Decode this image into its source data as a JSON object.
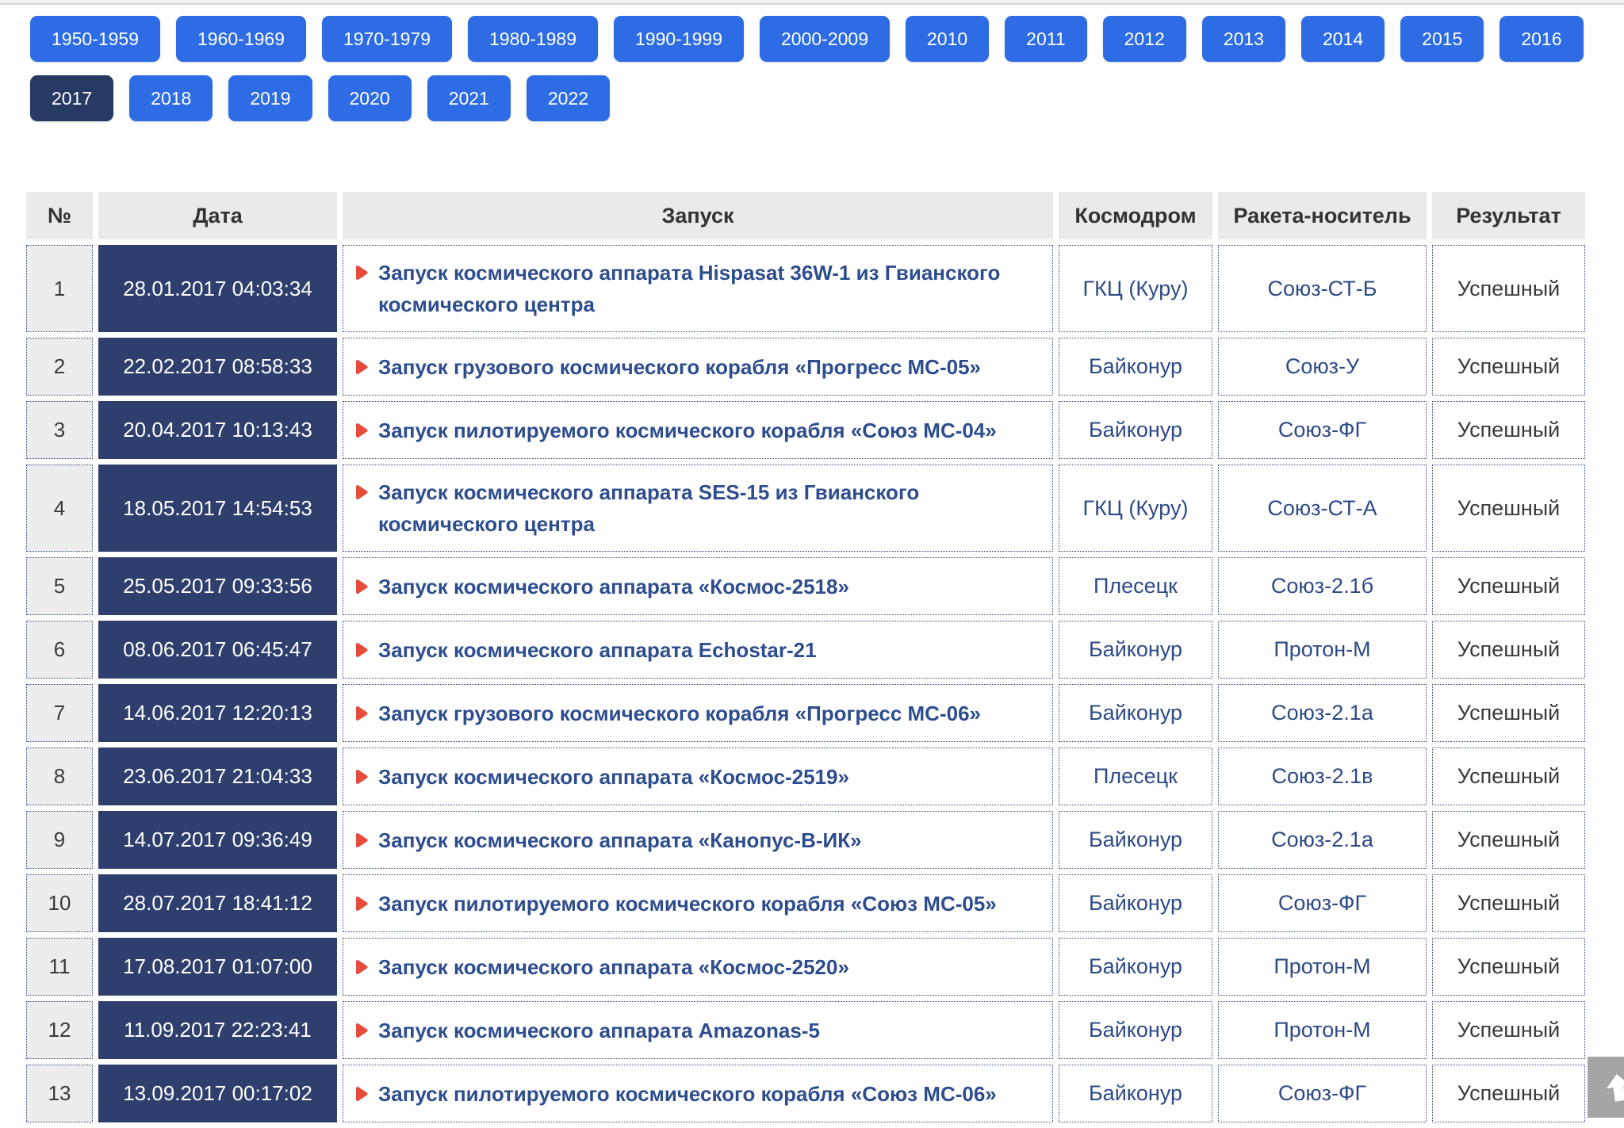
{
  "filters": {
    "active": "2017",
    "rows": [
      [
        "1950-1959",
        "1960-1969",
        "1970-1979",
        "1980-1989",
        "1990-1999",
        "2000-2009",
        "2010",
        "2011",
        "2012",
        "2013",
        "2014",
        "2015",
        "2016"
      ],
      [
        "2017",
        "2018",
        "2019",
        "2020",
        "2021",
        "2022"
      ]
    ]
  },
  "table": {
    "headers": [
      "№",
      "Дата",
      "Запуск",
      "Космодром",
      "Ракета-носитель",
      "Результат"
    ],
    "rows": [
      {
        "num": "1",
        "date": "28.01.2017 04:03:34",
        "launch": "Запуск космического аппарата Hispasat 36W-1 из Гвианского космического центра",
        "cosmodrome": "ГКЦ (Куру)",
        "rocket": "Союз-СТ-Б",
        "result": "Успешный"
      },
      {
        "num": "2",
        "date": "22.02.2017 08:58:33",
        "launch": "Запуск грузового космического корабля «Прогресс МС-05»",
        "cosmodrome": "Байконур",
        "rocket": "Союз-У",
        "result": "Успешный"
      },
      {
        "num": "3",
        "date": "20.04.2017 10:13:43",
        "launch": "Запуск пилотируемого космического корабля «Союз МС-04»",
        "cosmodrome": "Байконур",
        "rocket": "Союз-ФГ",
        "result": "Успешный"
      },
      {
        "num": "4",
        "date": "18.05.2017 14:54:53",
        "launch": "Запуск космического аппарата SES-15 из Гвианского космического центра",
        "cosmodrome": "ГКЦ (Куру)",
        "rocket": "Союз-СТ-А",
        "result": "Успешный"
      },
      {
        "num": "5",
        "date": "25.05.2017 09:33:56",
        "launch": "Запуск космического аппарата «Космос-2518»",
        "cosmodrome": "Плесецк",
        "rocket": "Союз-2.1б",
        "result": "Успешный"
      },
      {
        "num": "6",
        "date": "08.06.2017 06:45:47",
        "launch": "Запуск космического аппарата Echostar-21",
        "cosmodrome": "Байконур",
        "rocket": "Протон-М",
        "result": "Успешный"
      },
      {
        "num": "7",
        "date": "14.06.2017 12:20:13",
        "launch": "Запуск грузового космического корабля «Прогресс МС-06»",
        "cosmodrome": "Байконур",
        "rocket": "Союз-2.1а",
        "result": "Успешный"
      },
      {
        "num": "8",
        "date": "23.06.2017 21:04:33",
        "launch": "Запуск космического аппарата «Космос-2519»",
        "cosmodrome": "Плесецк",
        "rocket": "Союз-2.1в",
        "result": "Успешный"
      },
      {
        "num": "9",
        "date": "14.07.2017 09:36:49",
        "launch": "Запуск космического аппарата «Канопус-В-ИК»",
        "cosmodrome": "Байконур",
        "rocket": "Союз-2.1а",
        "result": "Успешный"
      },
      {
        "num": "10",
        "date": "28.07.2017 18:41:12",
        "launch": "Запуск пилотируемого космического корабля «Союз МС-05»",
        "cosmodrome": "Байконур",
        "rocket": "Союз-ФГ",
        "result": "Успешный"
      },
      {
        "num": "11",
        "date": "17.08.2017 01:07:00",
        "launch": "Запуск космического аппарата «Космос-2520»",
        "cosmodrome": "Байконур",
        "rocket": "Протон-М",
        "result": "Успешный"
      },
      {
        "num": "12",
        "date": "11.09.2017 22:23:41",
        "launch": "Запуск космического аппарата Amazonas-5",
        "cosmodrome": "Байконур",
        "rocket": "Протон-М",
        "result": "Успешный"
      },
      {
        "num": "13",
        "date": "13.09.2017 00:17:02",
        "launch": "Запуск пилотируемого космического корабля «Союз МС-06»",
        "cosmodrome": "Байконур",
        "rocket": "Союз-ФГ",
        "result": "Успешный"
      }
    ]
  },
  "icons": {
    "launch_marker": "red-triangle-icon",
    "scroll_top": "up-arrow-icon"
  },
  "colors": {
    "button_blue": "#2e6ce5",
    "button_active": "#263a64",
    "date_cell_navy": "#2e3f6d",
    "link_navy": "#2d4d8e",
    "value_navy": "#2d4a85",
    "dotted_border": "#36467c",
    "arrow_red": "#e64b3c",
    "header_gray": "#eaeaea",
    "num_cell_gray": "#ededed",
    "result_text": "#3a3a3a",
    "scroll_button_gray": "#a5a5a5"
  }
}
